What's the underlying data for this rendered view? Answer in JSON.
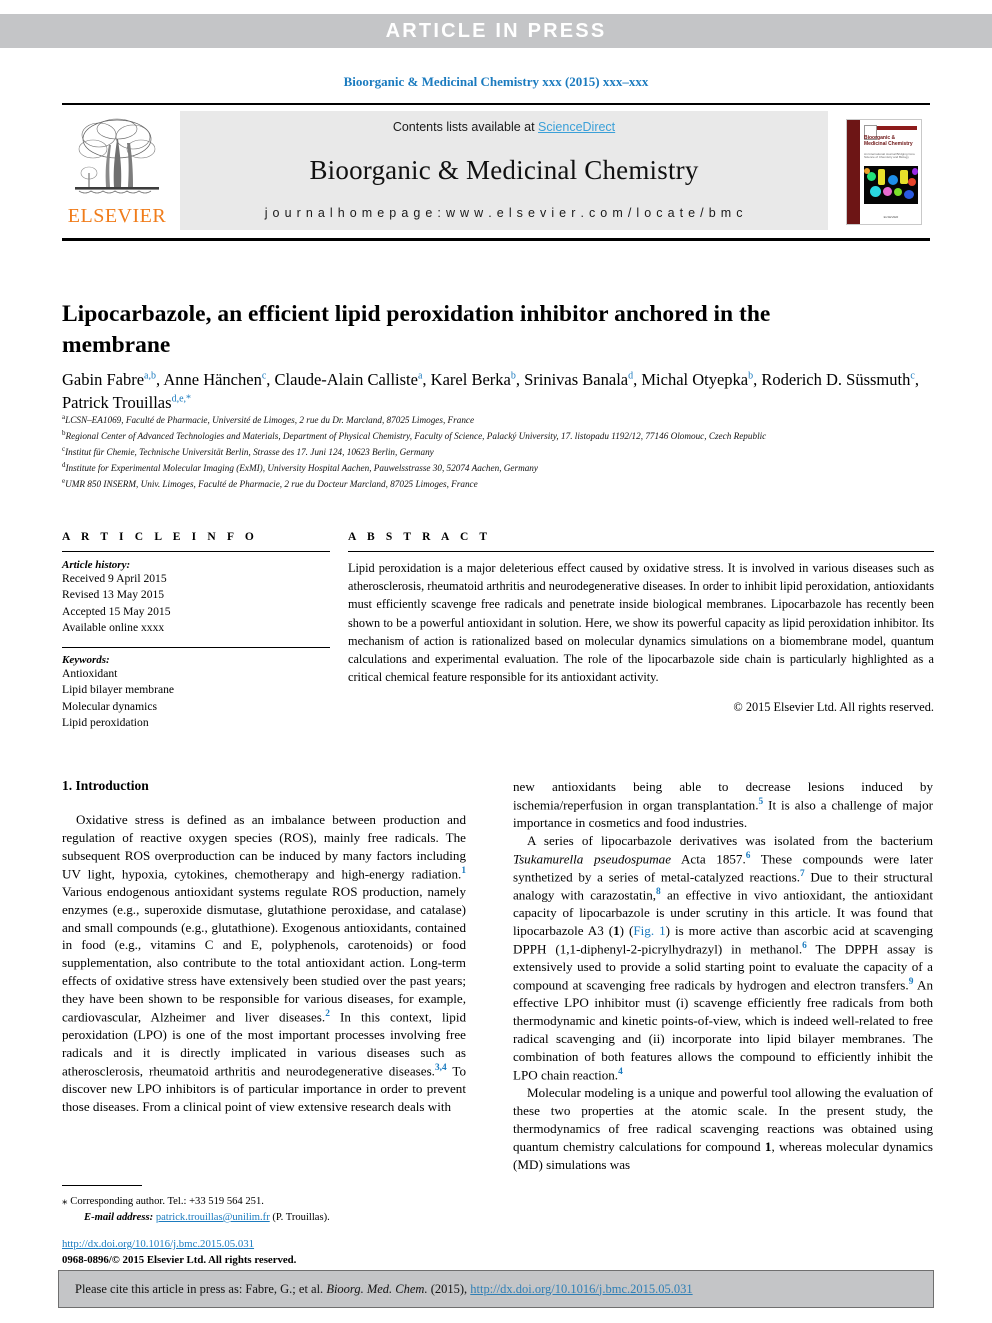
{
  "press_band": {
    "text": "ARTICLE  IN  PRESS"
  },
  "running_head": {
    "text": "Bioorganic & Medicinal Chemistry xxx (2015) xxx–xxx"
  },
  "journal_header": {
    "publisher": "ELSEVIER",
    "contents_prefix": "Contents lists available at ",
    "contents_link": "ScienceDirect",
    "journal_title": "Bioorganic & Medicinal Chemistry",
    "homepage": "j o u r n a l   h o m e p a g e :   w w w . e l s e v i e r . c o m / l o c a t e / b m c",
    "cover": {
      "title": "Bioorganic & Medicinal Chemistry",
      "subtitle": "An International Journal Bridging Core Science of Chemistry and Biology",
      "footer": "ELSEVIER"
    }
  },
  "article": {
    "title": "Lipocarbazole, an efficient lipid peroxidation inhibitor anchored in the membrane",
    "authors_html": "Gabin Fabre<sup>a,b</sup>, Anne Hänchen<sup>c</sup>, Claude-Alain Calliste<sup>a</sup>, Karel Berka<sup>b</sup>, Srinivas Banala<sup>d</sup>, Michal Otyepka<sup>b</sup>, Roderich D. Süssmuth<sup>c</sup>, Patrick Trouillas<sup>d,e,*</sup>",
    "affiliations": [
      {
        "marker": "a",
        "text": "LCSN–EA1069, Faculté de Pharmacie, Université de Limoges, 2 rue du Dr. Marcland, 87025 Limoges, France"
      },
      {
        "marker": "b",
        "text": "Regional Center of Advanced Technologies and Materials, Department of Physical Chemistry, Faculty of Science, Palacký University, 17. listopadu 1192/12, 77146 Olomouc, Czech Republic"
      },
      {
        "marker": "c",
        "text": "Institut für Chemie, Technische Universität Berlin, Strasse des 17. Juni 124, 10623 Berlin, Germany"
      },
      {
        "marker": "d",
        "text": "Institute for Experimental Molecular Imaging (ExMI), University Hospital Aachen, Pauwelsstrasse 30, 52074 Aachen, Germany"
      },
      {
        "marker": "e",
        "text": "UMR 850 INSERM, Univ. Limoges, Faculté de Pharmacie, 2 rue du Docteur Marcland, 87025 Limoges, France"
      }
    ]
  },
  "article_info": {
    "heading": "A R T I C L E   I N F O",
    "history_label": "Article history:",
    "history": [
      "Received 9 April 2015",
      "Revised 13 May 2015",
      "Accepted 15 May 2015",
      "Available online xxxx"
    ],
    "keywords_label": "Keywords:",
    "keywords": [
      "Antioxidant",
      "Lipid bilayer membrane",
      "Molecular dynamics",
      "Lipid peroxidation"
    ]
  },
  "abstract": {
    "heading": "A B S T R A C T",
    "body": "Lipid peroxidation is a major deleterious effect caused by oxidative stress. It is involved in various diseases such as atherosclerosis, rheumatoid arthritis and neurodegenerative diseases. In order to inhibit lipid peroxidation, antioxidants must efficiently scavenge free radicals and penetrate inside biological membranes. Lipocarbazole has recently been shown to be a powerful antioxidant in solution. Here, we show its powerful capacity as lipid peroxidation inhibitor. Its mechanism of action is rationalized based on molecular dynamics simulations on a biomembrane model, quantum calculations and experimental evaluation. The role of the lipocarbazole side chain is particularly highlighted as a critical chemical feature responsible for its antioxidant activity.",
    "copyright": "© 2015 Elsevier Ltd. All rights reserved."
  },
  "introduction": {
    "heading": "1. Introduction",
    "left_paragraph_html": "Oxidative stress is defined as an imbalance between production and regulation of reactive oxygen species (ROS), mainly free radicals. The subsequent ROS overproduction can be induced by many factors including UV light, hypoxia, cytokines, chemotherapy and high-energy radiation.<sup>1</sup> Various endogenous antioxidant systems regulate ROS production, namely enzymes (e.g., superoxide dismutase, glutathione peroxidase, and catalase) and small compounds (e.g., glutathione). Exogenous antioxidants, contained in food (e.g., vitamins C and E, polyphenols, carotenoids) or food supplementation, also contribute to the total antioxidant action. Long-term effects of oxidative stress have extensively been studied over the past years; they have been shown to be responsible for various diseases, for example, cardiovascular, Alzheimer and liver diseases.<sup>2</sup> In this context, lipid peroxidation (LPO) is one of the most important processes involving free radicals and it is directly implicated in various diseases such as atherosclerosis, rheumatoid arthritis and neurodegenerative diseases.<sup>3,4</sup> To discover new LPO inhibitors is of particular importance in order to prevent those diseases. From a clinical point of view extensive research deals with",
    "right_paragraph_1_html": "new antioxidants being able to decrease lesions induced by ischemia/reperfusion in organ transplantation.<sup>5</sup> It is also a challenge of major importance in cosmetics and food industries.",
    "right_paragraph_2_html": "A series of lipocarbazole derivatives was isolated from the bacterium <i>Tsukamurella pseudospumae</i> Acta 1857.<sup>6</sup> These compounds were later synthetized by a series of metal-catalyzed reactions.<sup>7</sup> Due to their structural analogy with carazostatin,<sup>8</sup> an effective in vivo antioxidant, the antioxidant capacity of lipocarbazole is under scrutiny in this article. It was found that lipocarbazole A3 (<b>1</b>) (<span class=\"figlink\">Fig. 1</span>) is more active than ascorbic acid at scavenging DPPH (1,1-diphenyl-2-picrylhydrazyl) in methanol.<sup>6</sup> The DPPH assay is extensively used to provide a solid starting point to evaluate the capacity of a compound at scavenging free radicals by hydrogen and electron transfers.<sup>9</sup> An effective LPO inhibitor must (i) scavenge efficiently free radicals from both thermodynamic and kinetic points-of-view, which is indeed well-related to free radical scavenging and (ii) incorporate into lipid bilayer membranes. The combination of both features allows the compound to efficiently inhibit the LPO chain reaction.<sup>4</sup>",
    "right_paragraph_3_html": "Molecular modeling is a unique and powerful tool allowing the evaluation of these two properties at the atomic scale. In the present study, the thermodynamics of free radical scavenging reactions was obtained using quantum chemistry calculations for compound <b>1</b>, whereas molecular dynamics (MD) simulations was"
  },
  "footnote": {
    "corresponding": "Corresponding author. Tel.: +33 519 564 251.",
    "email_label": "E-mail address:",
    "email": "patrick.trouillas@unilim.fr",
    "email_suffix": "(P. Trouillas)."
  },
  "doi_block": {
    "doi_url": "http://dx.doi.org/10.1016/j.bmc.2015.05.031",
    "issn_line": "0968-0896/© 2015 Elsevier Ltd. All rights reserved."
  },
  "citation_box": {
    "prefix": "Please cite this article in press as: Fabre, G.; et al. ",
    "journal_italic": "Bioorg. Med. Chem.",
    "middle": " (2015), ",
    "link": "http://dx.doi.org/10.1016/j.bmc.2015.05.031"
  },
  "colors": {
    "band_gray": "#c4c5c7",
    "link_blue": "#1b7bbf",
    "sciencedirect_blue": "#3ba0d8",
    "elsevier_orange": "#f07c1a",
    "cover_maroon": "#6d1515"
  }
}
